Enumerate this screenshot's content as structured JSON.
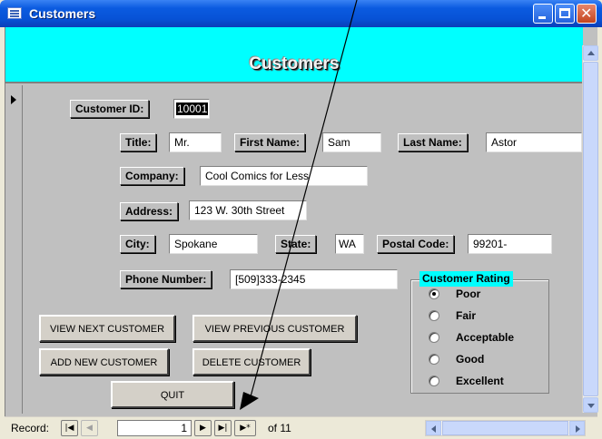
{
  "window": {
    "title": "Customers",
    "icon": "form-icon"
  },
  "header": {
    "title": "Customers",
    "color": "#00ffff"
  },
  "fields": {
    "customer_id": {
      "label": "Customer ID:",
      "value": "10001"
    },
    "title": {
      "label": "Title:",
      "value": "Mr."
    },
    "first_name": {
      "label": "First Name:",
      "value": "Sam"
    },
    "last_name": {
      "label": "Last Name:",
      "value": "Astor"
    },
    "company": {
      "label": "Company:",
      "value": "Cool Comics for Less"
    },
    "address": {
      "label": "Address:",
      "value": "123 W. 30th Street"
    },
    "city": {
      "label": "City:",
      "value": "Spokane"
    },
    "state": {
      "label": "State:",
      "value": "WA"
    },
    "postal_code": {
      "label": "Postal Code:",
      "value": "99201-"
    },
    "phone": {
      "label": "Phone Number:",
      "value": "[509]333-2345"
    }
  },
  "rating": {
    "label": "Customer Rating",
    "options": [
      "Poor",
      "Fair",
      "Acceptable",
      "Good",
      "Excellent"
    ],
    "selected": "Poor"
  },
  "buttons": {
    "view_next": "VIEW NEXT CUSTOMER",
    "view_previous": "VIEW PREVIOUS CUSTOMER",
    "add_new": "ADD NEW CUSTOMER",
    "delete": "DELETE CUSTOMER",
    "quit": "QUIT"
  },
  "navigation": {
    "label": "Record:",
    "current": "1",
    "of_text": "of 11",
    "first_glyph": "|◀",
    "prev_glyph": "◀",
    "next_glyph": "▶",
    "last_glyph": "▶|",
    "new_glyph": "▶*"
  }
}
